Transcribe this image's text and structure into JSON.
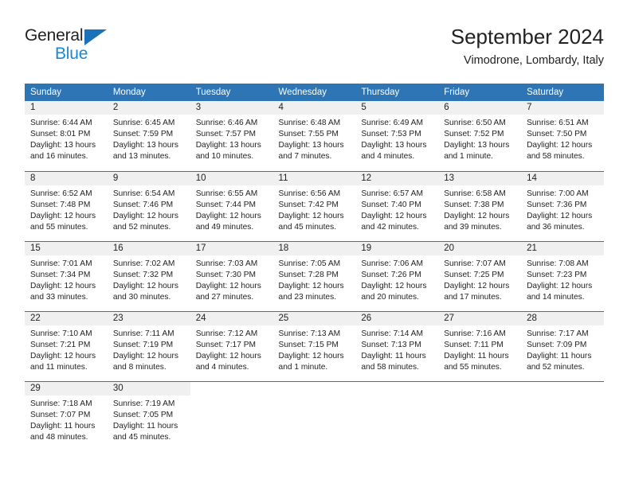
{
  "brand": {
    "name_top": "General",
    "name_bottom": "Blue",
    "triangle_color": "#1B72B8",
    "blue_text_color": "#1B87D6"
  },
  "header": {
    "title": "September 2024",
    "subtitle": "Vimodrone, Lombardy, Italy"
  },
  "theme": {
    "header_bg": "#2E75B6",
    "header_text": "#FFFFFF",
    "datenum_bg": "#F0F0F0",
    "body_text": "#222222",
    "page_bg": "#FFFFFF"
  },
  "calendar": {
    "weekday_headers": [
      "Sunday",
      "Monday",
      "Tuesday",
      "Wednesday",
      "Thursday",
      "Friday",
      "Saturday"
    ],
    "weeks": [
      [
        {
          "date": "1",
          "sunrise": "Sunrise: 6:44 AM",
          "sunset": "Sunset: 8:01 PM",
          "daylight_1": "Daylight: 13 hours",
          "daylight_2": "and 16 minutes."
        },
        {
          "date": "2",
          "sunrise": "Sunrise: 6:45 AM",
          "sunset": "Sunset: 7:59 PM",
          "daylight_1": "Daylight: 13 hours",
          "daylight_2": "and 13 minutes."
        },
        {
          "date": "3",
          "sunrise": "Sunrise: 6:46 AM",
          "sunset": "Sunset: 7:57 PM",
          "daylight_1": "Daylight: 13 hours",
          "daylight_2": "and 10 minutes."
        },
        {
          "date": "4",
          "sunrise": "Sunrise: 6:48 AM",
          "sunset": "Sunset: 7:55 PM",
          "daylight_1": "Daylight: 13 hours",
          "daylight_2": "and 7 minutes."
        },
        {
          "date": "5",
          "sunrise": "Sunrise: 6:49 AM",
          "sunset": "Sunset: 7:53 PM",
          "daylight_1": "Daylight: 13 hours",
          "daylight_2": "and 4 minutes."
        },
        {
          "date": "6",
          "sunrise": "Sunrise: 6:50 AM",
          "sunset": "Sunset: 7:52 PM",
          "daylight_1": "Daylight: 13 hours",
          "daylight_2": "and 1 minute."
        },
        {
          "date": "7",
          "sunrise": "Sunrise: 6:51 AM",
          "sunset": "Sunset: 7:50 PM",
          "daylight_1": "Daylight: 12 hours",
          "daylight_2": "and 58 minutes."
        }
      ],
      [
        {
          "date": "8",
          "sunrise": "Sunrise: 6:52 AM",
          "sunset": "Sunset: 7:48 PM",
          "daylight_1": "Daylight: 12 hours",
          "daylight_2": "and 55 minutes."
        },
        {
          "date": "9",
          "sunrise": "Sunrise: 6:54 AM",
          "sunset": "Sunset: 7:46 PM",
          "daylight_1": "Daylight: 12 hours",
          "daylight_2": "and 52 minutes."
        },
        {
          "date": "10",
          "sunrise": "Sunrise: 6:55 AM",
          "sunset": "Sunset: 7:44 PM",
          "daylight_1": "Daylight: 12 hours",
          "daylight_2": "and 49 minutes."
        },
        {
          "date": "11",
          "sunrise": "Sunrise: 6:56 AM",
          "sunset": "Sunset: 7:42 PM",
          "daylight_1": "Daylight: 12 hours",
          "daylight_2": "and 45 minutes."
        },
        {
          "date": "12",
          "sunrise": "Sunrise: 6:57 AM",
          "sunset": "Sunset: 7:40 PM",
          "daylight_1": "Daylight: 12 hours",
          "daylight_2": "and 42 minutes."
        },
        {
          "date": "13",
          "sunrise": "Sunrise: 6:58 AM",
          "sunset": "Sunset: 7:38 PM",
          "daylight_1": "Daylight: 12 hours",
          "daylight_2": "and 39 minutes."
        },
        {
          "date": "14",
          "sunrise": "Sunrise: 7:00 AM",
          "sunset": "Sunset: 7:36 PM",
          "daylight_1": "Daylight: 12 hours",
          "daylight_2": "and 36 minutes."
        }
      ],
      [
        {
          "date": "15",
          "sunrise": "Sunrise: 7:01 AM",
          "sunset": "Sunset: 7:34 PM",
          "daylight_1": "Daylight: 12 hours",
          "daylight_2": "and 33 minutes."
        },
        {
          "date": "16",
          "sunrise": "Sunrise: 7:02 AM",
          "sunset": "Sunset: 7:32 PM",
          "daylight_1": "Daylight: 12 hours",
          "daylight_2": "and 30 minutes."
        },
        {
          "date": "17",
          "sunrise": "Sunrise: 7:03 AM",
          "sunset": "Sunset: 7:30 PM",
          "daylight_1": "Daylight: 12 hours",
          "daylight_2": "and 27 minutes."
        },
        {
          "date": "18",
          "sunrise": "Sunrise: 7:05 AM",
          "sunset": "Sunset: 7:28 PM",
          "daylight_1": "Daylight: 12 hours",
          "daylight_2": "and 23 minutes."
        },
        {
          "date": "19",
          "sunrise": "Sunrise: 7:06 AM",
          "sunset": "Sunset: 7:26 PM",
          "daylight_1": "Daylight: 12 hours",
          "daylight_2": "and 20 minutes."
        },
        {
          "date": "20",
          "sunrise": "Sunrise: 7:07 AM",
          "sunset": "Sunset: 7:25 PM",
          "daylight_1": "Daylight: 12 hours",
          "daylight_2": "and 17 minutes."
        },
        {
          "date": "21",
          "sunrise": "Sunrise: 7:08 AM",
          "sunset": "Sunset: 7:23 PM",
          "daylight_1": "Daylight: 12 hours",
          "daylight_2": "and 14 minutes."
        }
      ],
      [
        {
          "date": "22",
          "sunrise": "Sunrise: 7:10 AM",
          "sunset": "Sunset: 7:21 PM",
          "daylight_1": "Daylight: 12 hours",
          "daylight_2": "and 11 minutes."
        },
        {
          "date": "23",
          "sunrise": "Sunrise: 7:11 AM",
          "sunset": "Sunset: 7:19 PM",
          "daylight_1": "Daylight: 12 hours",
          "daylight_2": "and 8 minutes."
        },
        {
          "date": "24",
          "sunrise": "Sunrise: 7:12 AM",
          "sunset": "Sunset: 7:17 PM",
          "daylight_1": "Daylight: 12 hours",
          "daylight_2": "and 4 minutes."
        },
        {
          "date": "25",
          "sunrise": "Sunrise: 7:13 AM",
          "sunset": "Sunset: 7:15 PM",
          "daylight_1": "Daylight: 12 hours",
          "daylight_2": "and 1 minute."
        },
        {
          "date": "26",
          "sunrise": "Sunrise: 7:14 AM",
          "sunset": "Sunset: 7:13 PM",
          "daylight_1": "Daylight: 11 hours",
          "daylight_2": "and 58 minutes."
        },
        {
          "date": "27",
          "sunrise": "Sunrise: 7:16 AM",
          "sunset": "Sunset: 7:11 PM",
          "daylight_1": "Daylight: 11 hours",
          "daylight_2": "and 55 minutes."
        },
        {
          "date": "28",
          "sunrise": "Sunrise: 7:17 AM",
          "sunset": "Sunset: 7:09 PM",
          "daylight_1": "Daylight: 11 hours",
          "daylight_2": "and 52 minutes."
        }
      ],
      [
        {
          "date": "29",
          "sunrise": "Sunrise: 7:18 AM",
          "sunset": "Sunset: 7:07 PM",
          "daylight_1": "Daylight: 11 hours",
          "daylight_2": "and 48 minutes."
        },
        {
          "date": "30",
          "sunrise": "Sunrise: 7:19 AM",
          "sunset": "Sunset: 7:05 PM",
          "daylight_1": "Daylight: 11 hours",
          "daylight_2": "and 45 minutes."
        },
        {
          "date": "",
          "sunrise": "",
          "sunset": "",
          "daylight_1": "",
          "daylight_2": ""
        },
        {
          "date": "",
          "sunrise": "",
          "sunset": "",
          "daylight_1": "",
          "daylight_2": ""
        },
        {
          "date": "",
          "sunrise": "",
          "sunset": "",
          "daylight_1": "",
          "daylight_2": ""
        },
        {
          "date": "",
          "sunrise": "",
          "sunset": "",
          "daylight_1": "",
          "daylight_2": ""
        },
        {
          "date": "",
          "sunrise": "",
          "sunset": "",
          "daylight_1": "",
          "daylight_2": ""
        }
      ]
    ]
  }
}
